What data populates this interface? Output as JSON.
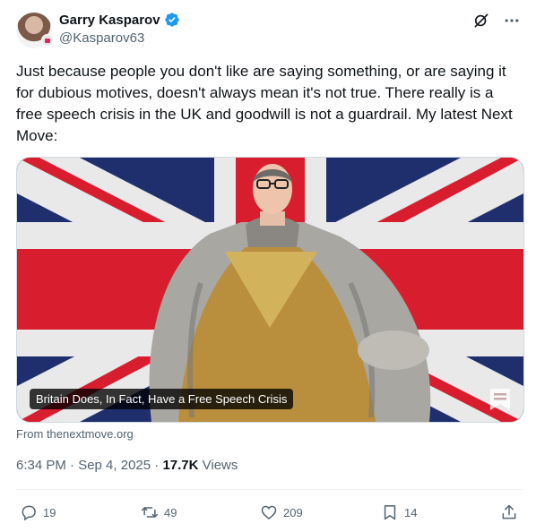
{
  "author": {
    "name": "Garry Kasparov",
    "handle": "@Kasparov63"
  },
  "tweet": {
    "text": "Just because people you don't like are saying something, or are saying it for dubious motives, doesn't always mean it's not true. There really is a free speech crisis in the UK and goodwill is not a guardrail. My latest Next Move:"
  },
  "card": {
    "caption": "Britain Does, In Fact, Have a Free Speech Crisis",
    "source": "From thenextmove.org"
  },
  "meta": {
    "time": "6:34 PM · Sep 4, 2025 · ",
    "views_count": "17.7K",
    "views_label": " Views"
  },
  "actions": {
    "replies": "19",
    "reposts": "49",
    "likes": "209",
    "bookmarks": "14"
  },
  "colors": {
    "flag_red": "#d81e2e",
    "flag_blue": "#1f2f6d",
    "verified": "#1d9bf0"
  },
  "icons": [
    "verified-icon",
    "grok-icon",
    "more-icon",
    "reply-icon",
    "repost-icon",
    "like-icon",
    "bookmark-icon",
    "share-icon"
  ]
}
